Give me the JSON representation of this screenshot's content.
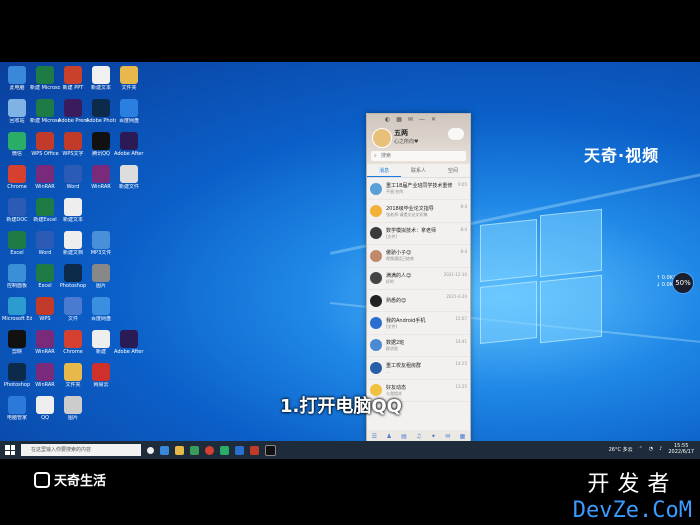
{
  "watermark_top": "天奇·视频",
  "caption": "1.打开电脑QQ",
  "bottom_logo": "天奇生活",
  "devze": {
    "cn": "开发者",
    "en": "DevZe.CoM"
  },
  "side_widget": {
    "percent": "50%",
    "line1": "↑ 0.0K/s",
    "line2": "↓ 0.0K/s"
  },
  "desktop_icons": [
    {
      "label": "此电脑",
      "color": "#3a88d9"
    },
    {
      "label": "新建 Microsoft Excel",
      "color": "#1e7b45"
    },
    {
      "label": "新建 PPT",
      "color": "#c9412a"
    },
    {
      "label": "新建文本",
      "color": "#f0f0f0"
    },
    {
      "label": "文件夹",
      "color": "#e8b84a"
    },
    {
      "label": "回收站",
      "color": "#7fb2e5"
    },
    {
      "label": "新建 Microsoft Excel",
      "color": "#1e7b45"
    },
    {
      "label": "Adobe Premiere",
      "color": "#3a1c5c"
    },
    {
      "label": "Adobe Photoshop",
      "color": "#0c2a4a"
    },
    {
      "label": "百度网盘",
      "color": "#2a7fe0"
    },
    {
      "label": "微信",
      "color": "#2aae67"
    },
    {
      "label": "WPS Office",
      "color": "#c23a2a"
    },
    {
      "label": "WPS文字",
      "color": "#c23a2a"
    },
    {
      "label": "腾讯QQ",
      "color": "#111"
    },
    {
      "label": "Adobe After Effects 2022",
      "color": "#2a1a55"
    },
    {
      "label": "Chrome",
      "color": "#d64030"
    },
    {
      "label": "WinRAR",
      "color": "#7a2a7a"
    },
    {
      "label": "Word",
      "color": "#2b5bb5"
    },
    {
      "label": "WinRAR",
      "color": "#7a2a7a"
    },
    {
      "label": "新建文件",
      "color": "#ddd"
    },
    {
      "label": "新建DOC",
      "color": "#2b5bb5"
    },
    {
      "label": "新建Excel",
      "color": "#1e7b45"
    },
    {
      "label": "新建文本",
      "color": "#eee"
    },
    {
      "label": "",
      "color": "transparent"
    },
    {
      "label": "",
      "color": "transparent"
    },
    {
      "label": "Excel",
      "color": "#1e7b45"
    },
    {
      "label": "Word",
      "color": "#2b5bb5"
    },
    {
      "label": "新建文档",
      "color": "#eee"
    },
    {
      "label": "MP3文件",
      "color": "#4a90d9"
    },
    {
      "label": "",
      "color": "transparent"
    },
    {
      "label": "控制面板",
      "color": "#3b8fd6"
    },
    {
      "label": "Excel",
      "color": "#1e7b45"
    },
    {
      "label": "Photoshop",
      "color": "#0c2a4a"
    },
    {
      "label": "图片",
      "color": "#888"
    },
    {
      "label": "",
      "color": "transparent"
    },
    {
      "label": "Microsoft Edge",
      "color": "#2b9bd0"
    },
    {
      "label": "WPS",
      "color": "#c23a2a"
    },
    {
      "label": "文件",
      "color": "#4a7bd1"
    },
    {
      "label": "百度网盘",
      "color": "#3a8fe0"
    },
    {
      "label": "",
      "color": "transparent"
    },
    {
      "label": "剪映",
      "color": "#111"
    },
    {
      "label": "WinRAR",
      "color": "#7a2a7a"
    },
    {
      "label": "Chrome",
      "color": "#d64030"
    },
    {
      "label": "新建",
      "color": "#eee"
    },
    {
      "label": "Adobe After Effects",
      "color": "#2a1a55"
    },
    {
      "label": "Photoshop",
      "color": "#0c2a4a"
    },
    {
      "label": "WinRAR",
      "color": "#7a2a7a"
    },
    {
      "label": "文件夹",
      "color": "#e8b84a"
    },
    {
      "label": "网易云",
      "color": "#d0302a"
    },
    {
      "label": "",
      "color": "transparent"
    },
    {
      "label": "电脑管家",
      "color": "#2b7ad9"
    },
    {
      "label": "QQ",
      "color": "#eee"
    },
    {
      "label": "图片",
      "color": "#ccc"
    },
    {
      "label": "",
      "color": "transparent"
    },
    {
      "label": "",
      "color": "transparent"
    }
  ],
  "qq": {
    "nickname": "五两",
    "signature": "心之所向♥",
    "search_placeholder": "搜索",
    "tabs": [
      "消息",
      "联系人",
      "空间"
    ],
    "messages": [
      {
        "name": "重工18届产业班同学技术重修",
        "preview": "平昌:在的",
        "time": "9:05",
        "color": "#5aa0d8"
      },
      {
        "name": "2018级毕业论文指导",
        "preview": "张老师:请提交论文初稿",
        "time": "8-4",
        "color": "#f3b13a"
      },
      {
        "name": "数学模拟技术：拿老师",
        "preview": "[文件]",
        "time": "8-4",
        "color": "#3a3a3a"
      },
      {
        "name": "傲骄小子😊",
        "preview": "视频通话已结束",
        "time": "8-4",
        "color": "#c08a6a"
      },
      {
        "name": "满满的人😊",
        "preview": "好的",
        "time": "2021-12-10",
        "color": "#444"
      },
      {
        "name": "熟悉的😊",
        "preview": "",
        "time": "2021-4-20",
        "color": "#222"
      },
      {
        "name": "我的Android手机",
        "preview": "[文件]",
        "time": "15:07",
        "color": "#2a6fd0"
      },
      {
        "name": "数据2班",
        "preview": "群消息",
        "time": "14:41",
        "color": "#4a8ad0"
      },
      {
        "name": "重工校友租房群",
        "preview": "...",
        "time": "14:25",
        "color": "#2a5fa8"
      },
      {
        "name": "好友动态",
        "preview": "与我相关",
        "time": "13:25",
        "color": "#f0c040"
      }
    ]
  },
  "taskbar": {
    "search_placeholder": "在这里输入你要搜索的内容",
    "weather": "26°C 多云",
    "time": "15:55",
    "date": "2022/6/17"
  }
}
